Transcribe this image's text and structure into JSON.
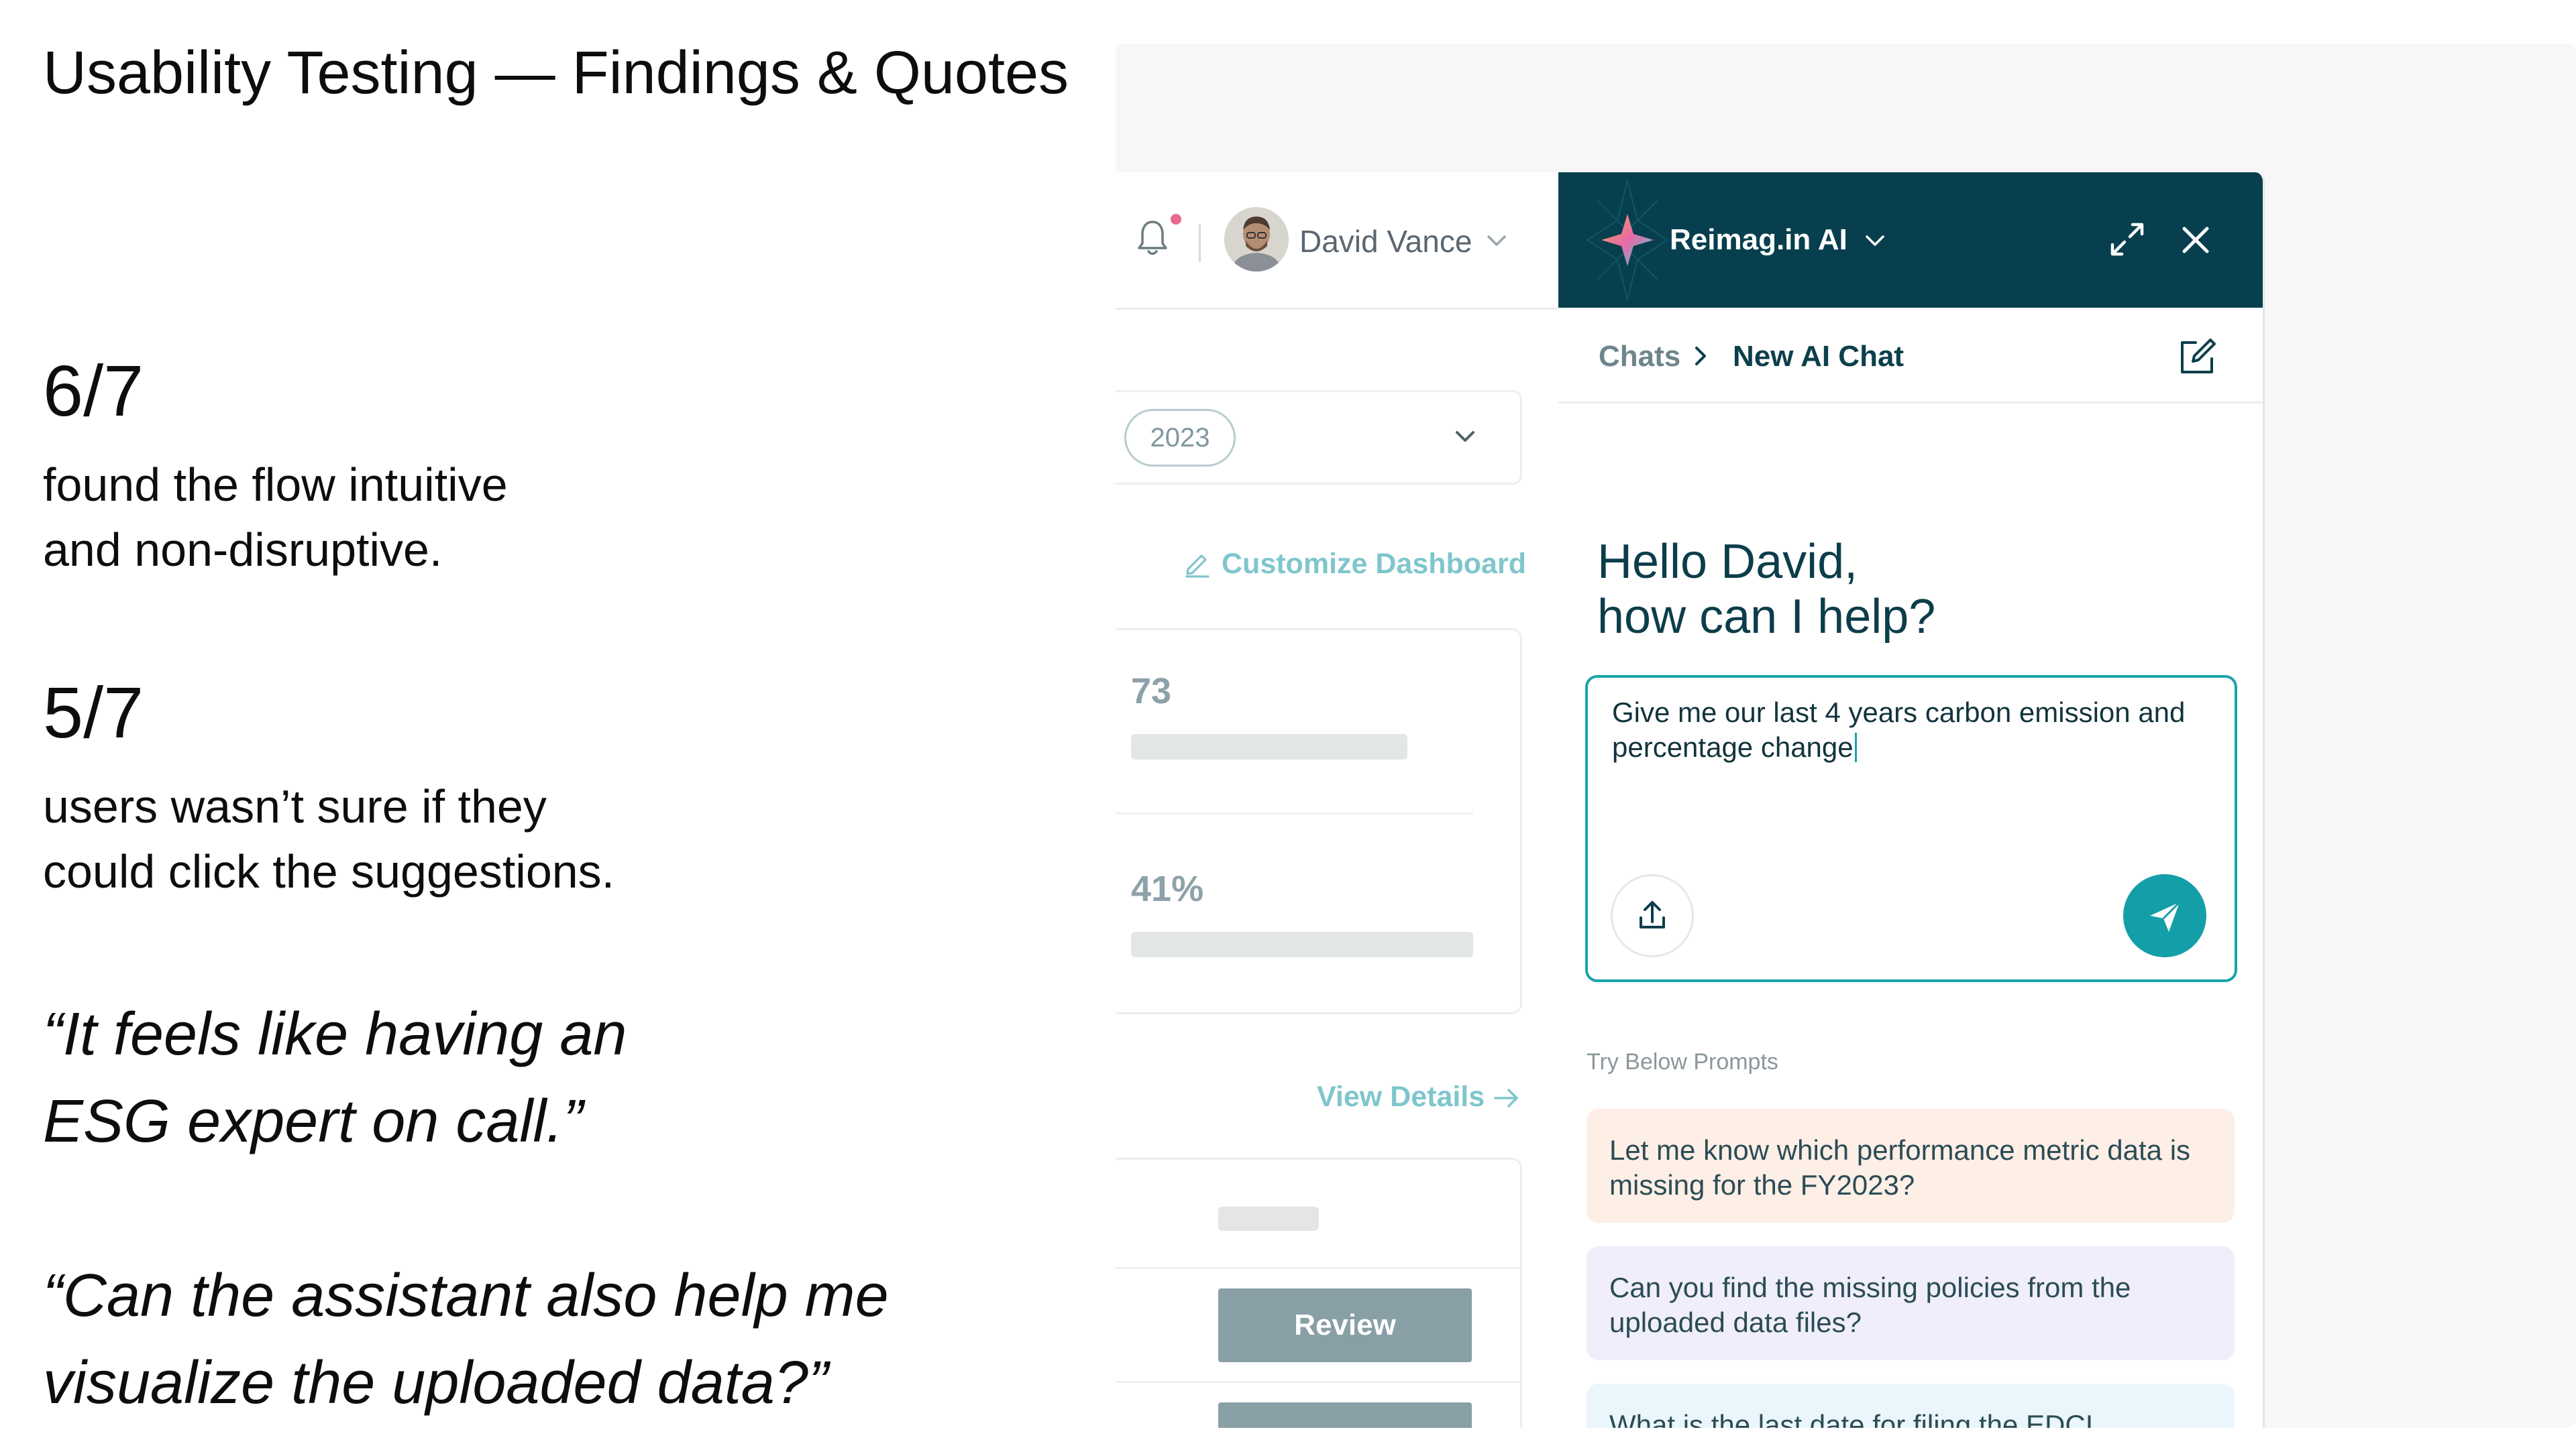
{
  "slide": {
    "title": "Usability Testing — Findings & Quotes",
    "findings": [
      {
        "stat": "6/7",
        "line1": "found the flow intuitive",
        "line2": "and non-disruptive."
      },
      {
        "stat": "5/7",
        "line1": "users wasn’t sure if they",
        "line2": "could click the suggestions."
      }
    ],
    "quotes": [
      {
        "line1": "“It feels like having an",
        "line2": "ESG expert on call.”"
      },
      {
        "line1": "“Can the assistant also help me",
        "line2": "visualize the uploaded data?”"
      }
    ]
  },
  "dashboard": {
    "user_name": "David Vance",
    "year": "2023",
    "customize_label": "Customize Dashboard",
    "metrics": [
      {
        "value": "73"
      },
      {
        "value": "41%"
      }
    ],
    "view_details_label": "View Details",
    "review_label": "Review"
  },
  "chat": {
    "title": "Reimag.in AI",
    "breadcrumb": {
      "root": "Chats",
      "current": "New AI Chat"
    },
    "greeting_line1": "Hello David,",
    "greeting_line2": "how can I help?",
    "input_value": "Give me our last 4 years carbon emission and percentage change",
    "prompts_label": "Try Below Prompts",
    "suggestions": [
      {
        "text": "Let me know which performance metric data is missing for the FY2023?",
        "bg": "#fdeee6"
      },
      {
        "text": "Can you find the missing policies from the uploaded data files?",
        "bg": "#f0eefb"
      },
      {
        "text": "What is the last date for filing the EDCI",
        "bg": "#eaf6fb"
      }
    ]
  },
  "colors": {
    "chat_header_bg": "#073f4e",
    "accent_teal": "#149fa8",
    "link_teal": "#7fc6cc",
    "notification_dot": "#e76a8e"
  },
  "icons": [
    "bell-icon",
    "chevron-down-icon",
    "edit-pencil-icon",
    "arrow-right-icon",
    "sparkle-logo-icon",
    "expand-icon",
    "close-icon",
    "chevron-right-icon",
    "new-chat-icon",
    "upload-icon",
    "send-icon"
  ]
}
